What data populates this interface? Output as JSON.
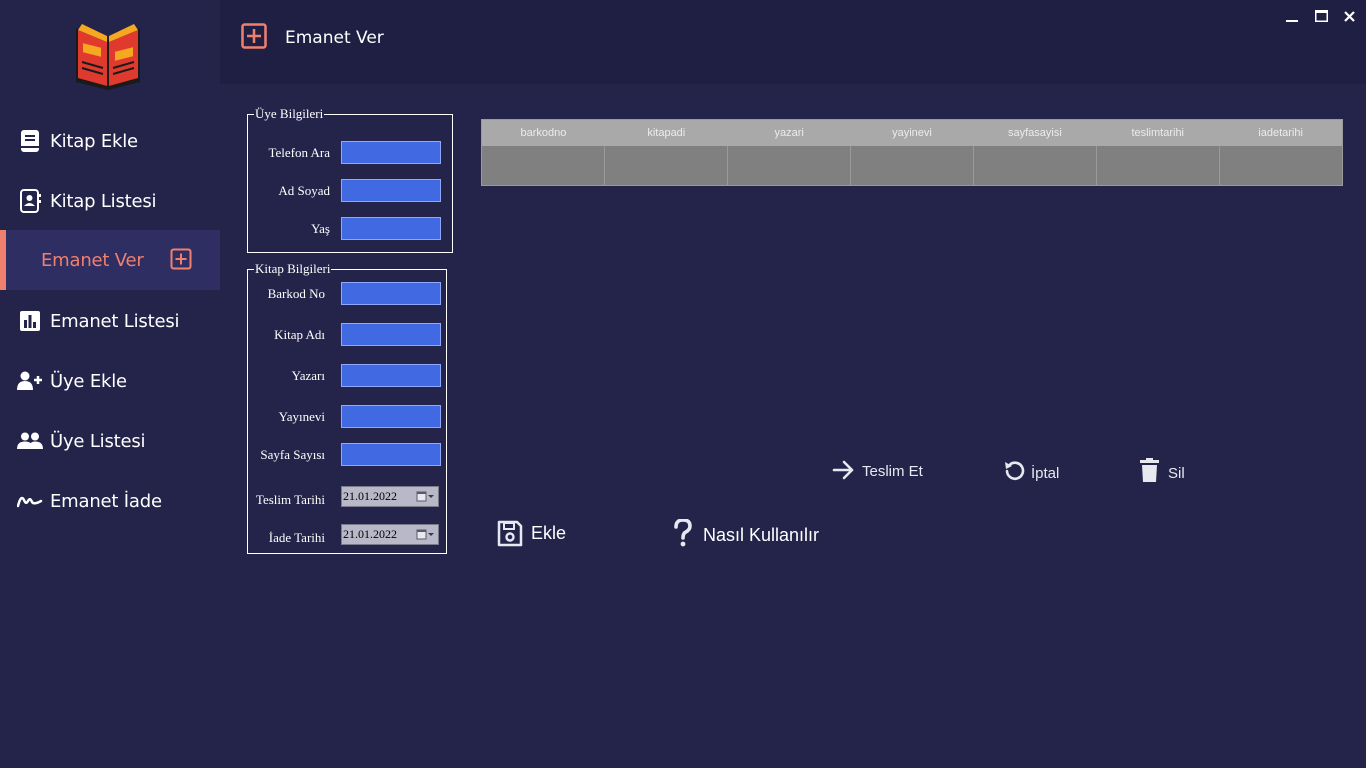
{
  "window": {
    "minimize_label": "_",
    "maximize_label": "□",
    "close_label": "✕"
  },
  "header": {
    "title": "Emanet Ver",
    "icon": "plus-square-icon"
  },
  "sidebar": {
    "logo": "open-book-logo",
    "items": [
      {
        "label": "Kitap Ekle",
        "icon": "book-icon"
      },
      {
        "label": "Kitap Listesi",
        "icon": "contact-book-icon"
      },
      {
        "label": "Emanet Ver",
        "icon": "plus-square-icon",
        "active": true
      },
      {
        "label": "Emanet Listesi",
        "icon": "bar-chart-icon"
      },
      {
        "label": "Üye Ekle",
        "icon": "user-plus-icon"
      },
      {
        "label": "Üye Listesi",
        "icon": "users-icon"
      },
      {
        "label": "Emanet İade",
        "icon": "signature-icon"
      }
    ]
  },
  "member_group": {
    "title": "Üye Bilgileri",
    "fields": [
      {
        "label": "Telefon Ara",
        "value": ""
      },
      {
        "label": "Ad Soyad",
        "value": ""
      },
      {
        "label": "Yaş",
        "value": ""
      }
    ]
  },
  "book_group": {
    "title": "Kitap Bilgileri",
    "fields": [
      {
        "label": "Barkod No",
        "value": ""
      },
      {
        "label": "Kitap Adı",
        "value": ""
      },
      {
        "label": "Yazarı",
        "value": ""
      },
      {
        "label": "Yayınevi",
        "value": ""
      },
      {
        "label": "Sayfa Sayısı",
        "value": ""
      }
    ],
    "dates": [
      {
        "label": "Teslim Tarihi",
        "value": "21.01.2022"
      },
      {
        "label": "İade Tarihi",
        "value": "21.01.2022"
      }
    ]
  },
  "table": {
    "columns": [
      "barkodno",
      "kitapadi",
      "yazari",
      "yayinevi",
      "sayfasayisi",
      "teslimtarihi",
      "iadetarihi"
    ],
    "rows": [
      [
        "",
        "",
        "",
        "",
        "",
        "",
        ""
      ]
    ]
  },
  "actions": {
    "deliver": "Teslim Et",
    "cancel": "İptal",
    "delete": "Sil",
    "add": "Ekle",
    "help": "Nasıl Kullanılır"
  },
  "colors": {
    "background": "#24244b",
    "header": "#1f1f44",
    "accent": "#f0806e",
    "input": "#4169e1",
    "table": "#808080"
  }
}
